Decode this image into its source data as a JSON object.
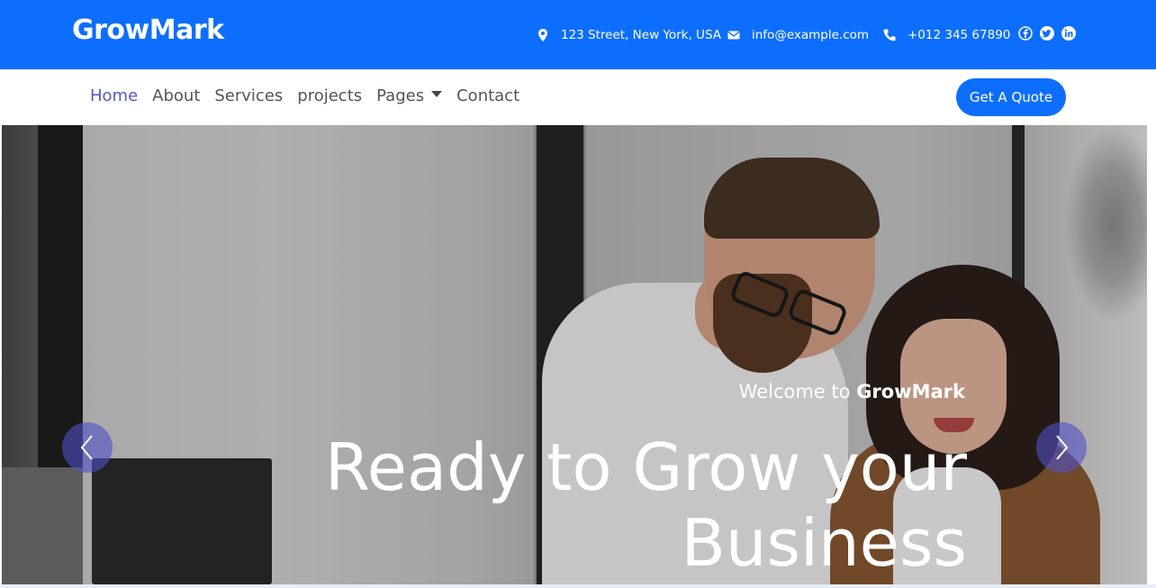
{
  "brand": "GrowMark",
  "topbar": {
    "address": "123 Street, New York, USA",
    "email": "info@example.com",
    "phone": "+012 345 67890",
    "social": [
      "facebook-icon",
      "twitter-icon",
      "linkedin-icon"
    ],
    "bg_color": "#0d6efd"
  },
  "nav": {
    "items": [
      {
        "label": "Home",
        "active": true
      },
      {
        "label": "About"
      },
      {
        "label": "Services"
      },
      {
        "label": "projects"
      },
      {
        "label": "Pages",
        "dropdown": true
      },
      {
        "label": "Contact"
      }
    ],
    "cta": "Get A Quote",
    "accent_color": "#0d6efd",
    "active_color": "#4f59c6"
  },
  "hero": {
    "welcome_prefix": "Welcome to",
    "welcome_brand": "GrowMark",
    "headline": "Ready to Grow your Business"
  }
}
